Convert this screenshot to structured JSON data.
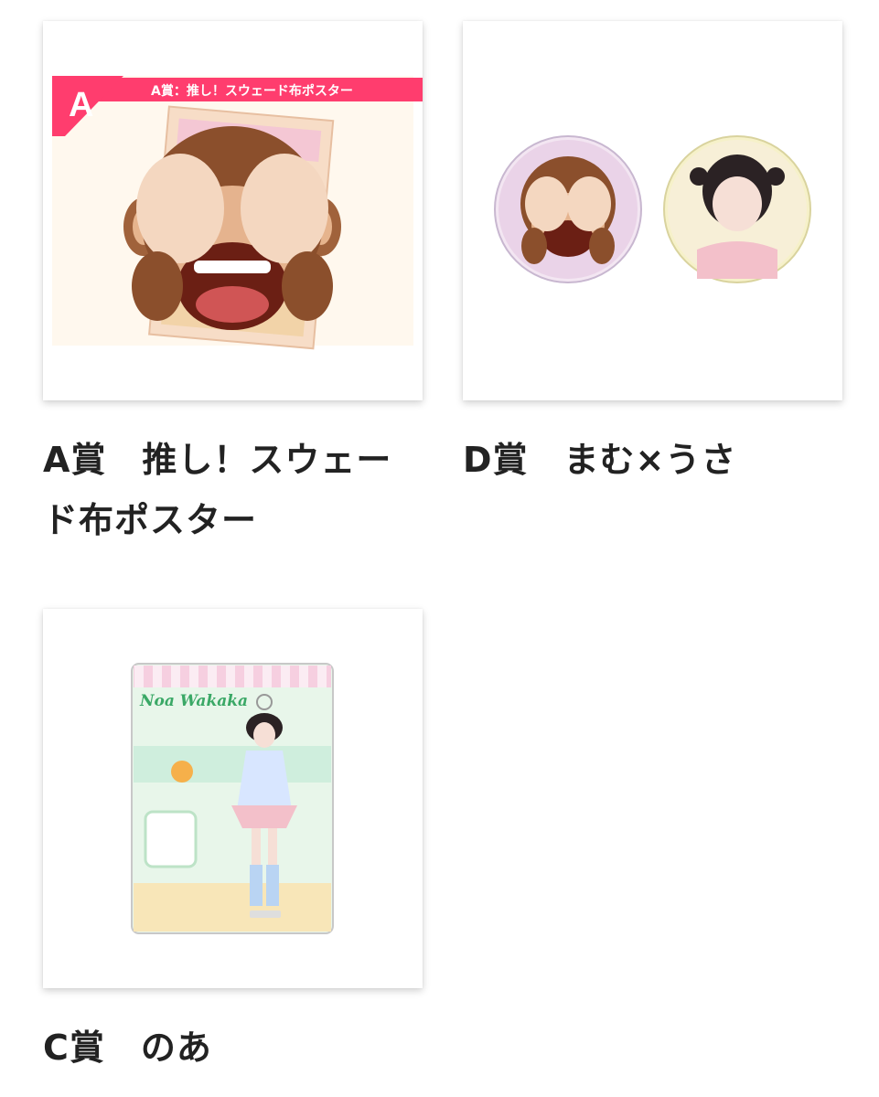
{
  "accent_color": "#ff3d6e",
  "text_color": "#222222",
  "items": [
    {
      "caption": "A賞　推し！スウェード布ポスター",
      "image": {
        "icon": "see-no-evil-monkey-icon",
        "badge_letter": "A",
        "banner_text": "A賞：推し！スウェード布ポスター"
      }
    },
    {
      "caption": "D賞　まむ×うさ",
      "image": {
        "icons": [
          "badge-monkey-icon",
          "badge-photo-icon"
        ]
      }
    },
    {
      "caption": "C賞　のあ",
      "image": {
        "icon": "acrylic-stand-icon",
        "nameplate_text": "Noa Wakaka"
      }
    }
  ]
}
